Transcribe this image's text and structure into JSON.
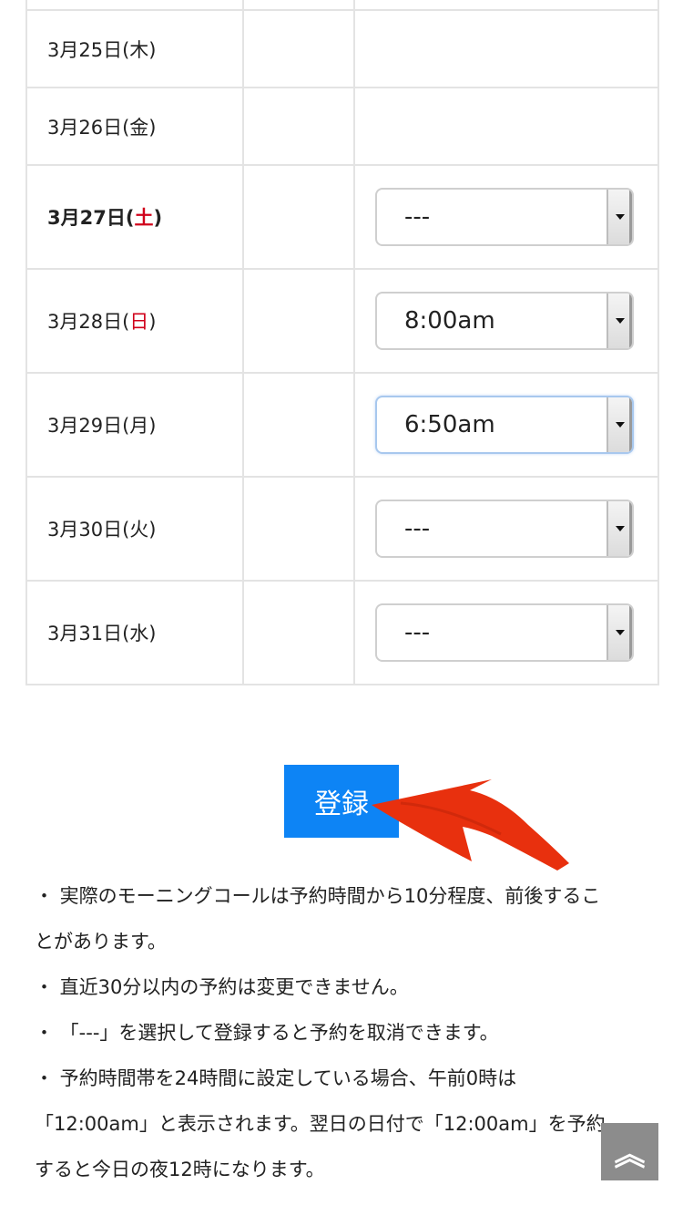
{
  "schedule": {
    "rows": [
      {
        "date": "3月25日(",
        "dow": "木",
        "close": ")",
        "dow_red": false,
        "bold": false,
        "select": null
      },
      {
        "date": "3月26日(",
        "dow": "金",
        "close": ")",
        "dow_red": false,
        "bold": false,
        "select": null
      },
      {
        "date": "3月27日(",
        "dow": "土",
        "close": ")",
        "dow_red": true,
        "bold": true,
        "select": "---"
      },
      {
        "date": "3月28日(",
        "dow": "日",
        "close": ")",
        "dow_red": true,
        "bold": false,
        "select": "8:00am"
      },
      {
        "date": "3月29日(",
        "dow": "月",
        "close": ")",
        "dow_red": false,
        "bold": false,
        "select": "6:50am",
        "focused": true
      },
      {
        "date": "3月30日(",
        "dow": "火",
        "close": ")",
        "dow_red": false,
        "bold": false,
        "select": "---"
      },
      {
        "date": "3月31日(",
        "dow": "水",
        "close": ")",
        "dow_red": false,
        "bold": false,
        "select": "---"
      }
    ]
  },
  "register_button": {
    "label": "登録"
  },
  "notes": {
    "line1": "・ 実際のモーニングコールは予約時間から10分程度、前後するこ",
    "line2": "とがあります。",
    "line3": "・ 直近30分以内の予約は変更できません。",
    "line4": "・ 「---」を選択して登録すると予約を取消できます。",
    "line5": "・ 予約時間帯を24時間に設定している場合、午前0時は",
    "line6": "「12:00am」と表示されます。翌日の日付で「12:00am」を予約",
    "line7": "すると今日の夜12時になります。"
  },
  "scroll_top": {
    "icon": "double-chevron-up-icon",
    "glyph": "︽"
  },
  "colors": {
    "accent": "#0d84f5",
    "weekend_red": "#d0021b",
    "arrow": "#e8300e"
  }
}
